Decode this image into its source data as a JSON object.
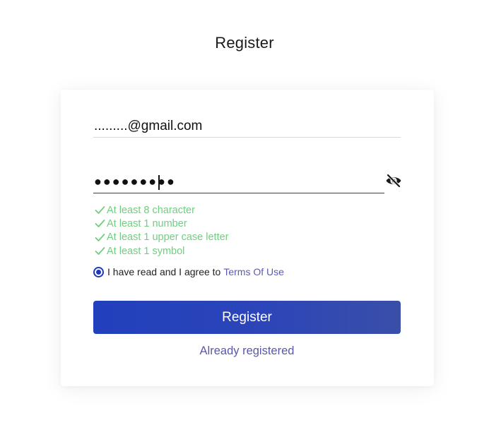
{
  "page": {
    "title": "Register"
  },
  "form": {
    "email": {
      "value": ".........@gmail.com"
    },
    "password": {
      "value": "●●●●●●●●●",
      "visibility_icon": "eye-slash-icon"
    },
    "rules": [
      {
        "label": "At least 8 character",
        "met": true
      },
      {
        "label": "At least 1 number",
        "met": true
      },
      {
        "label": "At least 1 upper case letter",
        "met": true
      },
      {
        "label": "At least 1 symbol",
        "met": true
      }
    ],
    "terms": {
      "text": "I have read and I agree to",
      "link": "Terms Of Use",
      "checked": true
    },
    "submit_label": "Register",
    "login_link": "Already registered"
  },
  "colors": {
    "accent": "#2240bd",
    "rule_ok": "#6fcf7f",
    "link": "#5b59b7"
  }
}
